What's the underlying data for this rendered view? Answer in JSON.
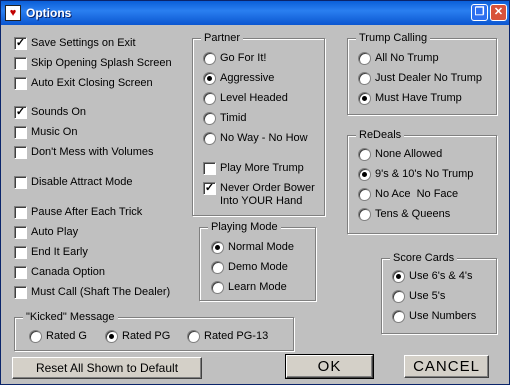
{
  "window": {
    "title": "Options",
    "app_icon": "card-icon",
    "restore_icon": "restore-icon",
    "close_icon": "close-icon"
  },
  "left_options": {
    "save_settings": {
      "label": "Save Settings on Exit",
      "checked": true
    },
    "skip_splash": {
      "label": "Skip Opening Splash Screen",
      "checked": false
    },
    "auto_exit_closing": {
      "label": "Auto Exit Closing Screen",
      "checked": false
    },
    "sounds_on": {
      "label": "Sounds On",
      "checked": true
    },
    "music_on": {
      "label": "Music On",
      "checked": false
    },
    "dont_mess_volumes": {
      "label": "Don't Mess with Volumes",
      "checked": false
    },
    "disable_attract": {
      "label": "Disable Attract Mode",
      "checked": false
    },
    "pause_after_trick": {
      "label": "Pause After Each Trick",
      "checked": false
    },
    "auto_play": {
      "label": "Auto Play",
      "checked": false
    },
    "end_it_early": {
      "label": "End It Early",
      "checked": false
    },
    "canada_option": {
      "label": "Canada Option",
      "checked": false
    },
    "must_call": {
      "label": "Must Call (Shaft The Dealer)",
      "checked": false
    }
  },
  "kicked": {
    "title": "\"Kicked\" Message",
    "options": [
      {
        "label": "Rated G",
        "selected": false
      },
      {
        "label": "Rated PG",
        "selected": true
      },
      {
        "label": "Rated PG-13",
        "selected": false
      }
    ]
  },
  "partner": {
    "title": "Partner",
    "options": [
      {
        "label": "Go For It!",
        "selected": false
      },
      {
        "label": "Aggressive",
        "selected": true
      },
      {
        "label": "Level Headed",
        "selected": false
      },
      {
        "label": "Timid",
        "selected": false
      },
      {
        "label": "No Way - No How",
        "selected": false
      }
    ],
    "play_more_trump": {
      "label": "Play More Trump",
      "checked": false
    },
    "never_order_bower": {
      "label": "Never Order Bower Into YOUR Hand",
      "checked": true
    }
  },
  "playing_mode": {
    "title": "Playing Mode",
    "options": [
      {
        "label": "Normal Mode",
        "selected": true
      },
      {
        "label": "Demo Mode",
        "selected": false
      },
      {
        "label": "Learn Mode",
        "selected": false
      }
    ]
  },
  "trump_calling": {
    "title": "Trump Calling",
    "options": [
      {
        "label": "All No Trump",
        "selected": false
      },
      {
        "label": "Just Dealer No Trump",
        "selected": false
      },
      {
        "label": "Must Have Trump",
        "selected": true
      }
    ]
  },
  "redeals": {
    "title": "ReDeals",
    "options": [
      {
        "label": "None Allowed",
        "selected": false
      },
      {
        "label": "9's & 10's No Trump",
        "selected": true
      },
      {
        "label": "No Ace  No Face",
        "selected": false
      },
      {
        "label": "Tens & Queens",
        "selected": false
      }
    ]
  },
  "score_cards": {
    "title": "Score Cards",
    "options": [
      {
        "label": "Use 6's & 4's",
        "selected": true
      },
      {
        "label": "Use 5's",
        "selected": false
      },
      {
        "label": "Use Numbers",
        "selected": false
      }
    ]
  },
  "buttons": {
    "reset": "Reset All Shown to Default",
    "ok": "OK",
    "cancel": "CANCEL"
  }
}
